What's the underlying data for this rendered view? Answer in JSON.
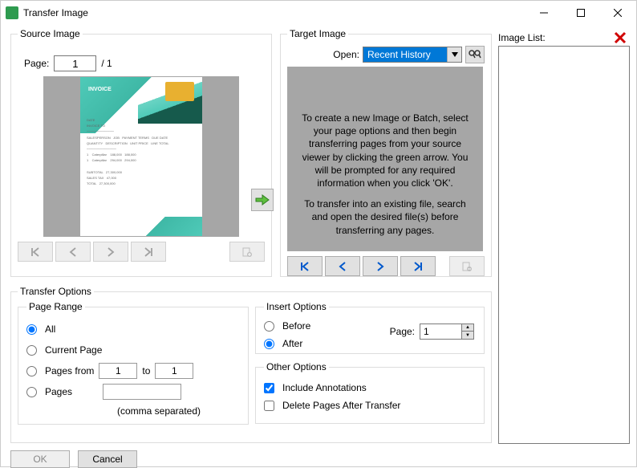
{
  "window": {
    "title": "Transfer Image"
  },
  "source": {
    "legend": "Source Image",
    "page_label": "Page:",
    "page_value": "1",
    "page_total": "/ 1",
    "invoice_title": "INVOICE"
  },
  "target": {
    "legend": "Target Image",
    "open_label": "Open:",
    "combo_value": "Recent History",
    "msg1": "To create a new Image or Batch, select your page options and then begin transferring pages from your source viewer by clicking the green arrow. You will be prompted for any required information when you click 'OK'.",
    "msg2": "To transfer into an existing file, search and open the desired file(s) before transferring any pages."
  },
  "image_list": {
    "label": "Image List:"
  },
  "transfer": {
    "legend": "Transfer Options",
    "page_range": {
      "legend": "Page Range",
      "all": "All",
      "current": "Current Page",
      "pages_from": "Pages from",
      "to": "to",
      "from_val": "1",
      "to_val": "1",
      "pages": "Pages",
      "comma": "(comma separated)"
    },
    "insert": {
      "legend": "Insert Options",
      "before": "Before",
      "after": "After",
      "page_label": "Page:",
      "page_value": "1"
    },
    "other": {
      "legend": "Other Options",
      "include": "Include Annotations",
      "delete": "Delete Pages After Transfer"
    }
  },
  "buttons": {
    "ok": "OK",
    "cancel": "Cancel"
  }
}
